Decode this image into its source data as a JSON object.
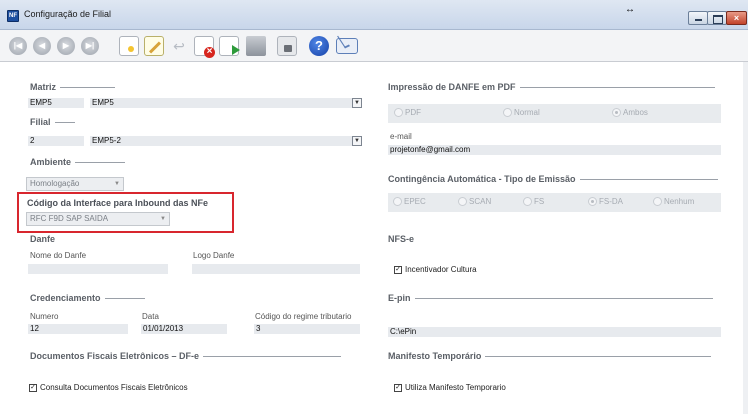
{
  "window": {
    "title": "Configuração de Filial",
    "resize_glyph": "↔"
  },
  "toolbar": {
    "icons": [
      "first-icon",
      "prev-icon",
      "next-icon",
      "last-icon",
      "new-icon",
      "edit-icon",
      "undo-icon",
      "delete-icon",
      "save-icon",
      "print-icon",
      "lock-icon",
      "help-icon",
      "mail-icon"
    ],
    "help_glyph": "?"
  },
  "left": {
    "matriz": {
      "title": "Matriz",
      "code": "EMP5",
      "name": "EMP5"
    },
    "filial": {
      "title": "Filial",
      "code": "2",
      "name": "EMP5-2"
    },
    "ambiente": {
      "title": "Ambiente",
      "value": "Homologação"
    },
    "inbound": {
      "title": "Código da Interface para Inbound das NFe",
      "value": "RFC F9D SAP SAIDA"
    },
    "danfe": {
      "title": "Danfe",
      "nome_label": "Nome do Danfe",
      "nome_value": "",
      "logo_label": "Logo Danfe",
      "logo_value": ""
    },
    "credenciamento": {
      "title": "Credenciamento",
      "numero_label": "Numero",
      "numero_value": "12",
      "data_label": "Data",
      "data_value": "01/01/2013",
      "regime_label": "Código do regime tributario",
      "regime_value": "3"
    },
    "dfe": {
      "title": "Documentos Fiscais Eletrônicos – DF-e",
      "check_label": "Consulta Documentos Fiscais Eletrônicos",
      "checked": true
    }
  },
  "right": {
    "impressao": {
      "title": "Impressão de DANFE em PDF",
      "options": [
        "PDF",
        "Normal",
        "Ambos"
      ],
      "selected": "Ambos"
    },
    "email": {
      "label": "e-mail",
      "value": "projetonfe@gmail.com"
    },
    "contingencia": {
      "title": "Contingência Automática - Tipo de Emissão",
      "options": [
        "EPEC",
        "SCAN",
        "FS",
        "FS-DA",
        "Nenhum"
      ],
      "selected": "FS-DA"
    },
    "nfse": {
      "title": "NFS-e",
      "check_label": "Incentivador Cultura",
      "checked": true
    },
    "epin": {
      "title": "E-pin",
      "value": "C:\\ePin"
    },
    "manifesto": {
      "title": "Manifesto Temporário",
      "check_label": "Utiliza Manifesto Temporario",
      "checked": true
    }
  },
  "colors": {
    "highlight": "#d8262e",
    "field_bg": "#e7eaee",
    "section_text": "#5a5f66"
  }
}
